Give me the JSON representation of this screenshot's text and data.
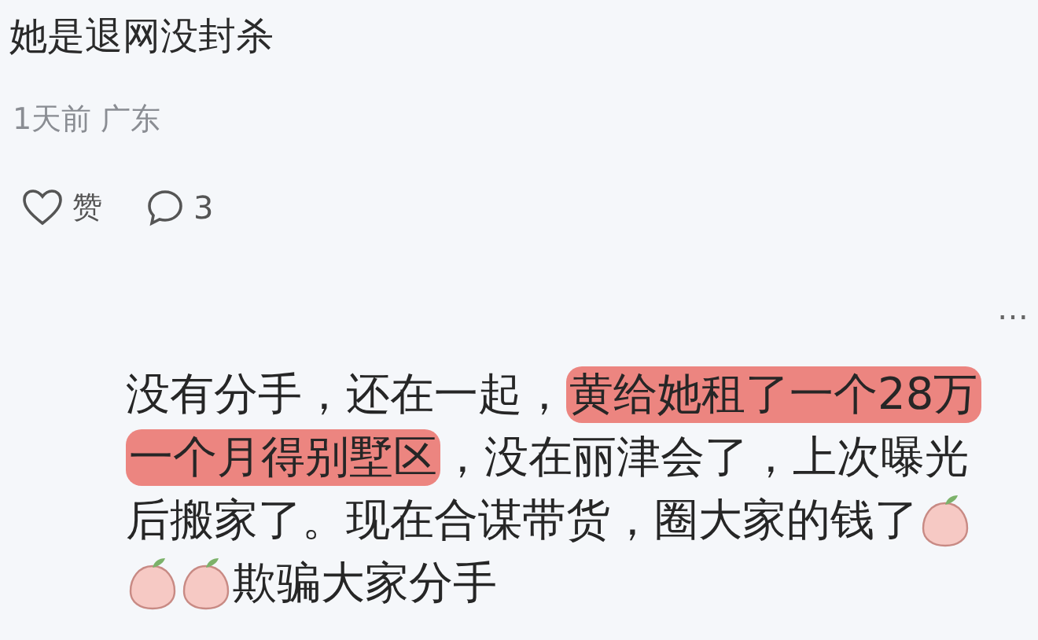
{
  "post": {
    "title": "她是退网没封杀",
    "meta": "1天前 广东",
    "like_label": "赞",
    "comment_count": "3"
  },
  "comment": {
    "more": "…",
    "lines": [
      [
        {
          "kind": "text",
          "text": "没有分手，还在一起，"
        },
        {
          "kind": "highlight",
          "text": "黄给她租了一个28万"
        }
      ],
      [
        {
          "kind": "highlight",
          "text": "一个月得别墅区"
        },
        {
          "kind": "text",
          "text": "，没在丽津会了，上次曝光"
        }
      ],
      [
        {
          "kind": "text",
          "text": "后搬家了。现在合谋带货，圈大家的钱了"
        },
        {
          "kind": "emoji"
        }
      ],
      [
        {
          "kind": "emoji"
        },
        {
          "kind": "emoji"
        },
        {
          "kind": "text",
          "text": "欺骗大家分手"
        }
      ]
    ]
  }
}
